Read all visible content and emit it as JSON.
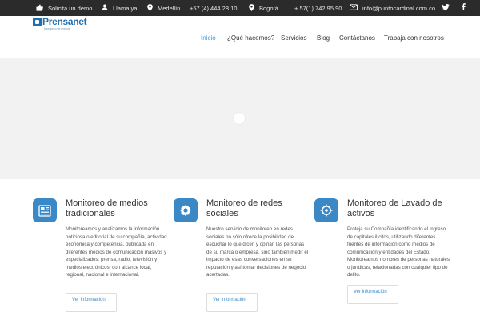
{
  "topbar": {
    "items": [
      {
        "icon": "thumbs-up-icon",
        "label": "Solicita un demo"
      },
      {
        "icon": "user-icon",
        "label": "Llama ya"
      },
      {
        "icon": "map-pin-icon",
        "label": "Medellín"
      },
      {
        "label": "+57 (4) 444 28 10"
      },
      {
        "icon": "map-pin-icon",
        "label": "Bogotá"
      },
      {
        "label": "+ 57(1) 742 95 90"
      },
      {
        "icon": "envelope-icon",
        "label": "info@puntocardinal.com.co"
      }
    ],
    "social": [
      {
        "icon": "twitter-icon"
      },
      {
        "icon": "facebook-icon"
      }
    ]
  },
  "logo": {
    "name": "Prensanet",
    "tagline": "Monitoreo de medios"
  },
  "nav": {
    "items": [
      {
        "label": "Inicio",
        "active": true
      },
      {
        "label": "¿Qué hacemos?",
        "active": false
      },
      {
        "label": "Servicios",
        "active": false
      },
      {
        "label": "Blog",
        "active": false
      },
      {
        "label": "Contáctanos",
        "active": false
      },
      {
        "label": "Trabaja con nosotros",
        "active": false
      }
    ]
  },
  "colors": {
    "accent": "#3a88c6",
    "nav_active": "#3aa0d8",
    "topbar_bg": "#2b2b2b",
    "hero_bg": "#f2f2f2"
  },
  "services": [
    {
      "icon": "newspaper-icon",
      "title": "Monitoreo de medios tradicionales",
      "text": "Monitoreamos y analizamos la información noticiosa o editorial de su compañía, actividad económica y competencia,  publicada en diferentes medios de comunicación masivos y especializados: prensa, radio, televisión y medios electrónicos; con alcance local, regional, nacional e internacional.",
      "button": "Ver información"
    },
    {
      "icon": "gear-icon",
      "title": "Monitoreo de redes sociales",
      "text": "Nuestro servicio de monitoreo en redes sociales no sólo ofrece la posibilidad de escuchar lo que dicen y opinan las personas de su marca o empresa, sino también medir el impacto de esas conversaciones en su reputación y así tomar decisiones de negocio acertadas.",
      "button": "Ver información"
    },
    {
      "icon": "target-icon",
      "title": "Monitoreo de Lavado de activos",
      "text": "Proteja su Compañía identificando el ingreso de capitales ilícitos, utilizando diferentes fuentes de información como medios de comunicación y entidades del Estado. Monitoreamos nombres de personas naturales o jurídicas, relacionadas con cualquier tipo de delito.",
      "button": "Ver información"
    }
  ]
}
